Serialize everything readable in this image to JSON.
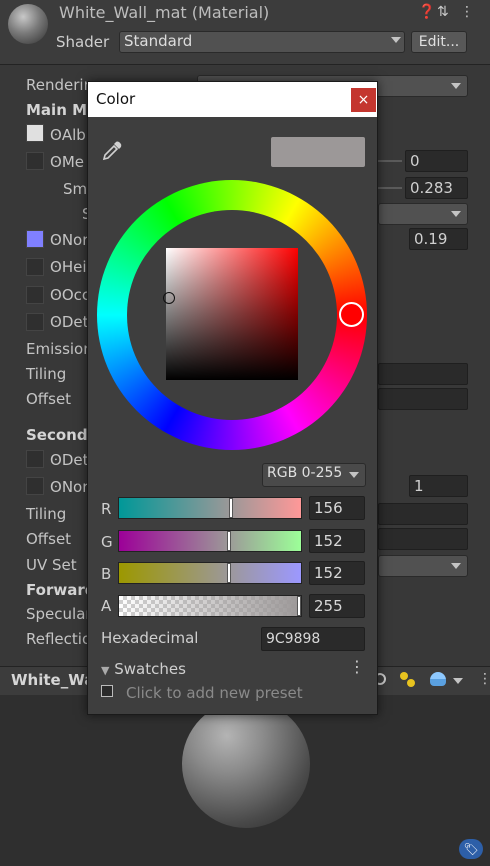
{
  "header": {
    "title": "White_Wall_mat (Material)",
    "shader_label": "Shader",
    "shader_value": "Standard",
    "edit_button": "Edit...",
    "icons": [
      "help-icon",
      "preset-icon",
      "menu-kebab-icon"
    ]
  },
  "inspector": {
    "rendering_mode": "Renderin",
    "main_maps": "Main Ma",
    "albedo": "Alb",
    "metallic": "Me",
    "metallic_value": "0",
    "smoothness": "Sm",
    "smoothness_value": "0.283",
    "source": "S",
    "normal": "Nor",
    "normal_value": "0.19",
    "height": "Hei",
    "occlusion": "Occ",
    "detail_mask": "Det",
    "emission": "Emission",
    "tiling": "Tiling",
    "offset": "Offset",
    "secondary": "Seconda",
    "detail_albedo": "Det",
    "detail_normal": "Nor",
    "detail_normal_value": "1",
    "tiling2": "Tiling",
    "offset2": "Offset",
    "uv_set": "UV Set",
    "forward": "Forward",
    "specular": "Specular",
    "reflections": "Reflectio"
  },
  "preview": {
    "name": "White_Wa"
  },
  "color_picker": {
    "title": "Color",
    "close": "×",
    "mode": "RGB 0-255",
    "current_color": "#9c9898",
    "channels": [
      {
        "label": "R",
        "value": "156",
        "fraction": 0.612
      },
      {
        "label": "G",
        "value": "152",
        "fraction": 0.596
      },
      {
        "label": "B",
        "value": "152",
        "fraction": 0.596
      },
      {
        "label": "A",
        "value": "255",
        "fraction": 1.0
      }
    ],
    "hex_label": "Hexadecimal",
    "hex_value": "9C9898",
    "swatches_label": "Swatches",
    "add_preset": "Click to add new preset"
  }
}
